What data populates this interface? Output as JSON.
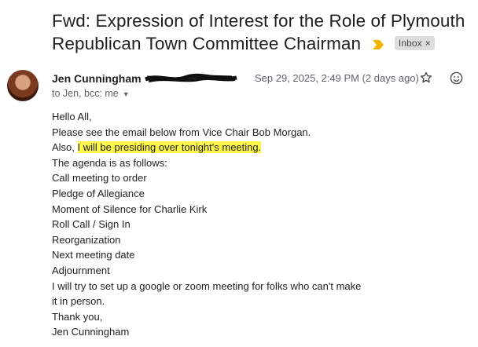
{
  "email": {
    "subject": "Fwd: Expression of Interest for the Role of Plymouth Republican Town Committee Chairman",
    "label": "Inbox",
    "label_close": "×",
    "important_marker_color": "#f4b400",
    "sender_name": "Jen Cunningham",
    "date": "Sep 29, 2025, 2:49 PM (2 days ago)",
    "recipients": "to Jen, bcc: me",
    "icons": {
      "important": "importance-marker-icon",
      "star": "star-icon",
      "emoji": "emoji-react-icon",
      "caret": "chevron-down-icon"
    },
    "body": {
      "greeting": "Hello All,",
      "line1": "Please see the email below from Vice Chair Bob Morgan.",
      "line2_prefix": "Also, ",
      "line2_highlight": "I will be presiding over tonight's meeting.",
      "highlight_color": "#fdf64a",
      "agenda_intro": "The agenda is as follows:",
      "agenda": [
        "Call meeting to order",
        "Pledge of Allegiance",
        "Moment of Silence for Charlie Kirk",
        "Roll Call / Sign In",
        "Reorganization",
        "Next meeting date",
        "Adjournment"
      ],
      "closing_line1": "I will try to set up a google or zoom meeting for folks who can't make",
      "closing_line2": "it in person.",
      "signoff": "Thank you,",
      "signature": "Jen Cunningham"
    }
  }
}
